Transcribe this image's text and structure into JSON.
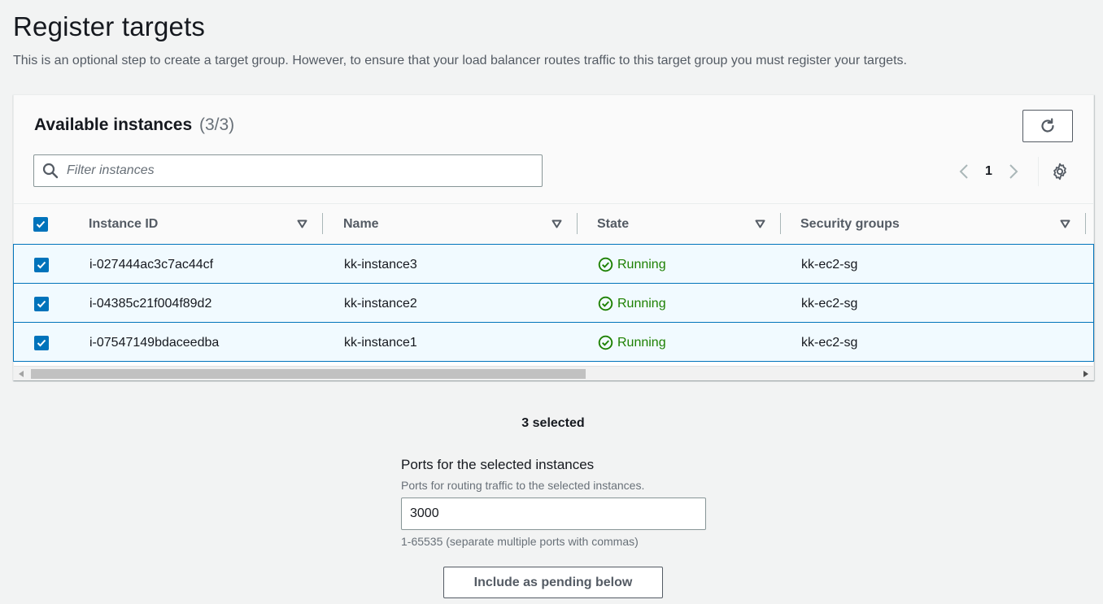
{
  "page": {
    "title": "Register targets",
    "description": "This is an optional step to create a target group. However, to ensure that your load balancer routes traffic to this target group you must register your targets."
  },
  "instances_panel": {
    "title": "Available instances",
    "count": "(3/3)",
    "filter_placeholder": "Filter instances",
    "current_page": "1",
    "icons": [
      "refresh-icon",
      "search-icon",
      "chevron-left-icon",
      "chevron-right-icon",
      "gear-icon"
    ]
  },
  "table": {
    "columns": [
      "Instance ID",
      "Name",
      "State",
      "Security groups"
    ],
    "rows": [
      {
        "instance_id": "i-027444ac3c7ac44cf",
        "name": "kk-instance3",
        "state": "Running",
        "security_groups": "kk-ec2-sg",
        "selected": true
      },
      {
        "instance_id": "i-04385c21f004f89d2",
        "name": "kk-instance2",
        "state": "Running",
        "security_groups": "kk-ec2-sg",
        "selected": true
      },
      {
        "instance_id": "i-07547149bdaceedba",
        "name": "kk-instance1",
        "state": "Running",
        "security_groups": "kk-ec2-sg",
        "selected": true
      }
    ]
  },
  "selection": {
    "summary": "3 selected",
    "ports_label": "Ports for the selected instances",
    "ports_description": "Ports for routing traffic to the selected instances.",
    "ports_value": "3000",
    "ports_hint": "1-65535 (separate multiple ports with commas)",
    "include_button": "Include as pending below"
  },
  "colors": {
    "accent": "#0073bb",
    "running": "#1d8102",
    "row_selected_bg": "#f1faff"
  }
}
